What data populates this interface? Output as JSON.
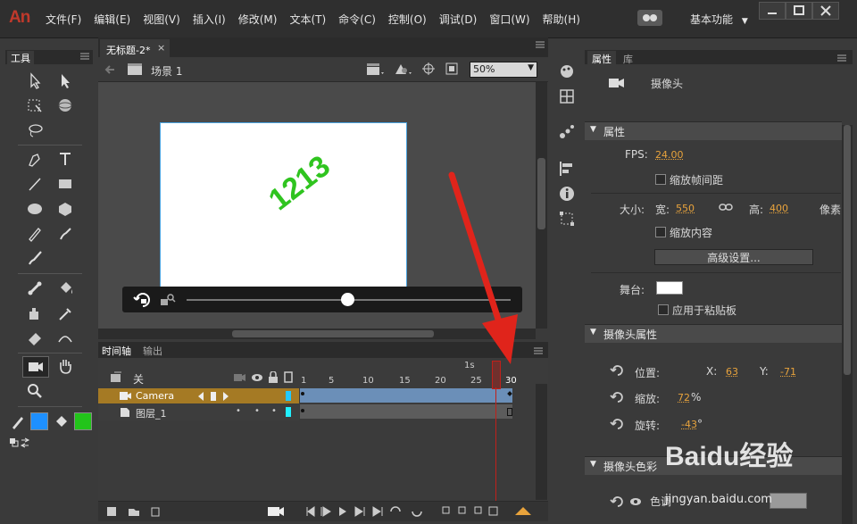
{
  "app": {
    "logo": "An"
  },
  "menu": {
    "items": [
      "文件(F)",
      "编辑(E)",
      "视图(V)",
      "插入(I)",
      "修改(M)",
      "文本(T)",
      "命令(C)",
      "控制(O)",
      "调试(D)",
      "窗口(W)",
      "帮助(H)"
    ],
    "workspace": "基本功能"
  },
  "tools": {
    "tab_label": "工具"
  },
  "document": {
    "tab_title": "无标题-2*",
    "scene": "场景 1",
    "zoom": "50%",
    "stage_text": "1213",
    "stage_text_color": "#2fc41f"
  },
  "timeline": {
    "tabs": [
      "时间轴",
      "输出"
    ],
    "header_label": "关",
    "second_marker": "1s",
    "ruler": [
      "1",
      "5",
      "10",
      "15",
      "20",
      "25",
      "30"
    ],
    "layers": [
      {
        "name": "Camera",
        "selected": true
      },
      {
        "name": "图层_1",
        "selected": false
      }
    ]
  },
  "properties": {
    "tabs": [
      "属性",
      "库"
    ],
    "object_name": "摄像头",
    "section_properties": "属性",
    "fps_label": "FPS:",
    "fps_value": "24.00",
    "scale_spacing": "缩放帧间距",
    "size_label": "大小:",
    "width_label": "宽:",
    "width_value": "550",
    "height_label": "高:",
    "height_value": "400",
    "unit": "像素",
    "scale_content": "缩放内容",
    "advanced": "高级设置...",
    "stage_label": "舞台:",
    "stage_color": "#ffffff",
    "apply_pasteboard": "应用于粘贴板",
    "section_camera": "摄像头属性",
    "position_label": "位置:",
    "x_label": "X:",
    "x_value": "63",
    "y_label": "Y:",
    "y_value": "-71",
    "zoom_label": "缩放:",
    "zoom_value": "72",
    "zoom_unit": "%",
    "rotate_label": "旋转:",
    "rotate_value": "-43",
    "rotate_unit": "°",
    "section_color": "摄像头色彩",
    "color_row_label": "色调"
  },
  "colors": {
    "accent_orange": "#e8a33c",
    "fill_blue": "#1e90ff",
    "fill_green": "#22c41a",
    "arrow_red": "#e0241b",
    "playhead_red": "#c0201a"
  },
  "watermark": {
    "brand": "Baidu经验",
    "url": "jingyan.baidu.com"
  }
}
